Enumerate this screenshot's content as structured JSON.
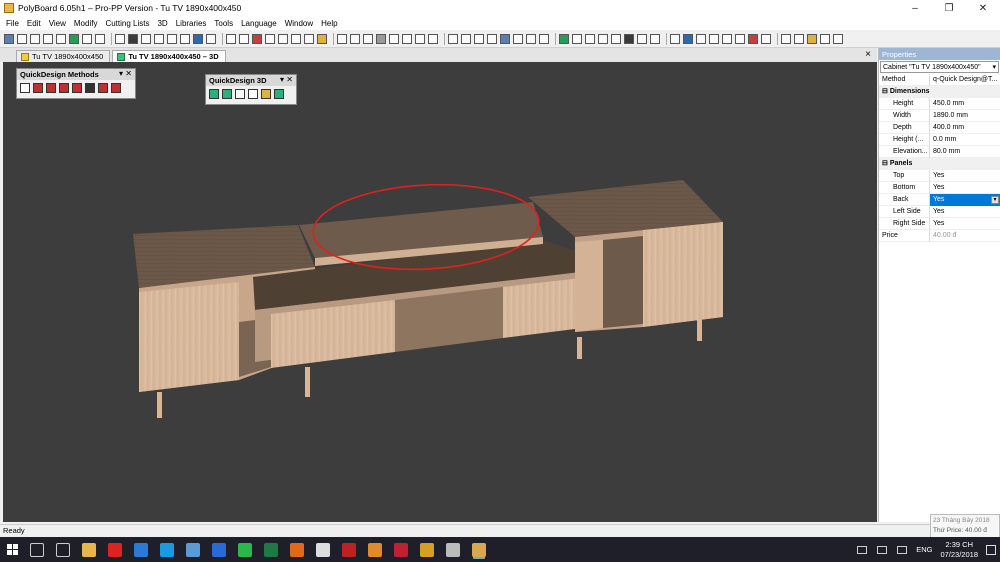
{
  "window": {
    "title": "PolyBoard 6.05h1 – Pro-PP Version - Tu TV 1890x400x450",
    "controls": [
      "–",
      "❐",
      "✕"
    ]
  },
  "menu": [
    "File",
    "Edit",
    "View",
    "Modify",
    "Cutting Lists",
    "3D",
    "Libraries",
    "Tools",
    "Language",
    "Window",
    "Help"
  ],
  "tabs": [
    {
      "label": "Tu TV 1890x400x450",
      "active": false
    },
    {
      "label": "Tu TV 1890x400x450 – 3D",
      "active": true
    }
  ],
  "tab_close": "×",
  "panels": {
    "quickdesign_methods": {
      "title": "QuickDesign Methods",
      "controls": "▾ ✕"
    },
    "quickdesign_3d": {
      "title": "QuickDesign 3D",
      "controls": "▾ ✕"
    }
  },
  "properties": {
    "header": "Properties",
    "selector": "Cabinet \"Tu TV 1890x400x450\"",
    "method": {
      "label": "Method",
      "value": "q-Quick Design@T..."
    },
    "groups": [
      {
        "name": "Dimensions",
        "sign": "⊟",
        "rows": [
          {
            "label": "Height",
            "value": "450.0 mm"
          },
          {
            "label": "Width",
            "value": "1890.0 mm"
          },
          {
            "label": "Depth",
            "value": "400.0 mm"
          },
          {
            "label": "Height (...",
            "value": "0.0 mm"
          },
          {
            "label": "Elevation...",
            "value": "80.0 mm"
          }
        ]
      },
      {
        "name": "Panels",
        "sign": "⊟",
        "rows": [
          {
            "label": "Top",
            "value": "Yes"
          },
          {
            "label": "Bottom",
            "value": "Yes"
          },
          {
            "label": "Back",
            "value": "Yes",
            "selected": true
          },
          {
            "label": "Left Side",
            "value": "Yes"
          },
          {
            "label": "Right Side",
            "value": "Yes"
          }
        ]
      }
    ],
    "price": {
      "label": "Price",
      "value": "40.00 đ"
    }
  },
  "status": {
    "text": "Ready"
  },
  "tooltip": {
    "line1": "23 Tháng Bảy 2018",
    "line2": "Thứ Price: 40.00 đ"
  },
  "taskbar": {
    "lang": "ENG",
    "time": "2:39 CH",
    "date": "07/23/2018"
  },
  "colors": {
    "viewport_bg": "#3d3d3d",
    "wood_light": "#d8b79a",
    "wood_top": "#6e5a4a",
    "annotation": "#e0201e",
    "selection": "#0078d7"
  }
}
